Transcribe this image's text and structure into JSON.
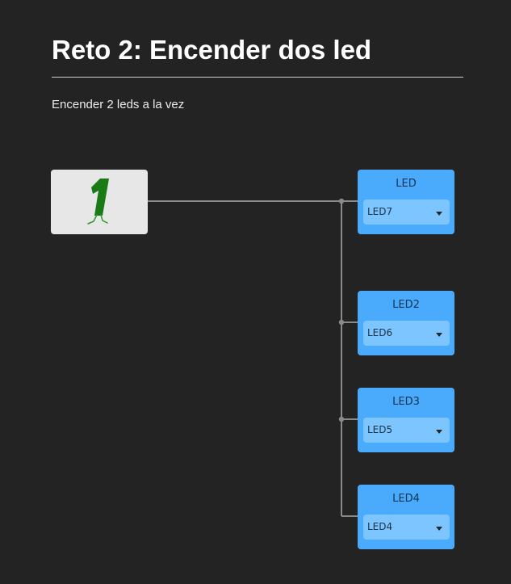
{
  "header": {
    "title": "Reto 2: Encender dos led",
    "subtitle": "Encender 2 leds a la vez"
  },
  "source_block": {
    "icon": "digit-one-walking-icon",
    "accent_color": "#1a7a16"
  },
  "led_blocks": [
    {
      "title": "LED",
      "selected": "LED7"
    },
    {
      "title": "LED2",
      "selected": "LED6"
    },
    {
      "title": "LED3",
      "selected": "LED5"
    },
    {
      "title": "LED4",
      "selected": "LED4"
    }
  ],
  "colors": {
    "background": "#232323",
    "led_block": "#4aabfd",
    "led_select": "#7cc5ff",
    "wire": "#8a8a8a",
    "source_block": "#e7e7e7"
  }
}
